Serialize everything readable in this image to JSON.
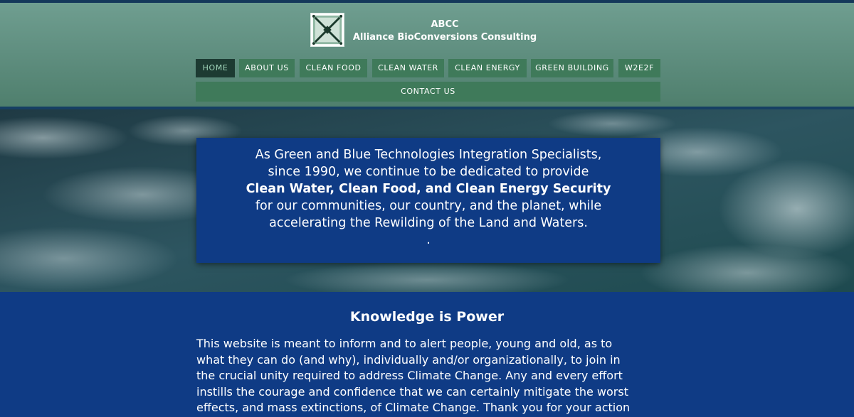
{
  "brand": {
    "abbr": "ABCC",
    "name": "Alliance BioConversions Consulting",
    "logo_icon": "x-frame-logo-icon"
  },
  "nav": {
    "items": [
      {
        "label": "HOME",
        "active": true
      },
      {
        "label": "ABOUT US"
      },
      {
        "label": "CLEAN FOOD"
      },
      {
        "label": "CLEAN WATER"
      },
      {
        "label": "CLEAN ENERGY"
      },
      {
        "label": "GREEN BUILDING"
      },
      {
        "label": "W2E2F"
      },
      {
        "label": "CONTACT US"
      }
    ]
  },
  "hero": {
    "lines": [
      "As Green and Blue Technologies Integration Specialists,",
      "since 1990, we continue to be dedicated to provide",
      "Clean Water, Clean Food, and Clean Energy Security",
      "for our communities, our country, and the planet, while",
      "accelerating the Rewilding of the Land and Waters.",
      "."
    ]
  },
  "knowledge": {
    "heading": "Knowledge is Power",
    "lines": [
      "This website is meant to inform and to alert people, young and old, as to",
      "what they can do (and why), individually and/or organizationally, to join in",
      "the crucial unity required to address Climate Change. Any and every effort",
      "instills the courage and confidence that we can certainly mitigate the worst",
      "effects, and mass extinctions, of Climate Change. Thank you for your action"
    ]
  },
  "colors": {
    "header_green": "#5f8e7f",
    "nav_green": "#3f7a5a",
    "nav_active": "#1d3b32",
    "navy": "#0f3b85"
  }
}
